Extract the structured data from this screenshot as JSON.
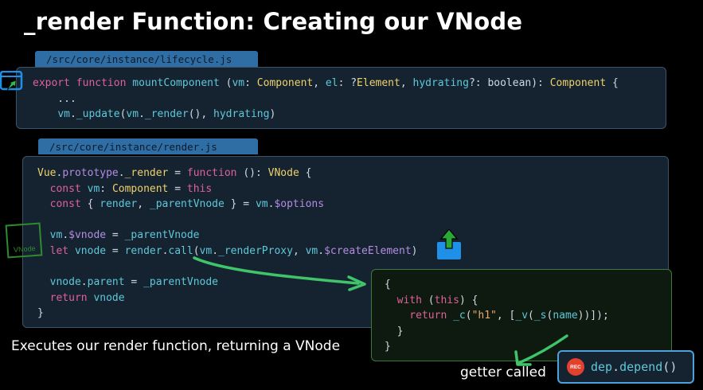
{
  "slide": {
    "title": "_render Function: Creating our VNode"
  },
  "block1": {
    "file": "/src/core/instance/lifecycle.js",
    "lines": [
      [
        [
          "kw",
          "export "
        ],
        [
          "kw",
          "function "
        ],
        [
          "fn",
          "mountComponent "
        ],
        [
          "pl",
          "("
        ],
        [
          "fn",
          "vm"
        ],
        [
          "pl",
          ": "
        ],
        [
          "ty",
          "Component"
        ],
        [
          "pl",
          ", "
        ],
        [
          "fn",
          "el"
        ],
        [
          "pl",
          ": ?"
        ],
        [
          "ty",
          "Element"
        ],
        [
          "pl",
          ", "
        ],
        [
          "fn",
          "hydrating"
        ],
        [
          "pl",
          "?: "
        ],
        [
          "pl",
          "boolean"
        ],
        [
          "pl",
          "): "
        ],
        [
          "ty",
          "Component"
        ],
        [
          "pl",
          " {"
        ]
      ],
      [
        [
          "pl",
          "    ..."
        ]
      ],
      [
        [
          "pl",
          "    "
        ],
        [
          "fn",
          "vm"
        ],
        [
          "pl",
          "."
        ],
        [
          "fn",
          "_update"
        ],
        [
          "pl",
          "("
        ],
        [
          "fn",
          "vm"
        ],
        [
          "pl",
          "."
        ],
        [
          "fn",
          "_render"
        ],
        [
          "pl",
          "(), "
        ],
        [
          "fn",
          "hydrating"
        ],
        [
          "pl",
          ")"
        ]
      ]
    ]
  },
  "block2": {
    "file": "/src/core/instance/render.js",
    "lines": [
      [
        [
          "ty",
          "Vue"
        ],
        [
          "pl",
          "."
        ],
        [
          "pr",
          "prototype"
        ],
        [
          "pl",
          "."
        ],
        [
          "ty",
          "_render"
        ],
        [
          "pl",
          " = "
        ],
        [
          "kw",
          "function "
        ],
        [
          "pl",
          "(): "
        ],
        [
          "ty",
          "VNode"
        ],
        [
          "pl",
          " {"
        ]
      ],
      [
        [
          "kw",
          "  const "
        ],
        [
          "fn",
          "vm"
        ],
        [
          "pl",
          ": "
        ],
        [
          "ty",
          "Component"
        ],
        [
          "pl",
          " = "
        ],
        [
          "kw",
          "this"
        ]
      ],
      [
        [
          "kw",
          "  const "
        ],
        [
          "pl",
          "{ "
        ],
        [
          "fn",
          "render"
        ],
        [
          "pl",
          ", "
        ],
        [
          "fn",
          "_parentVnode"
        ],
        [
          "pl",
          " } = "
        ],
        [
          "fn",
          "vm"
        ],
        [
          "pl",
          "."
        ],
        [
          "pr",
          "$options"
        ]
      ],
      [
        [
          "pl",
          ""
        ]
      ],
      [
        [
          "pl",
          "  "
        ],
        [
          "fn",
          "vm"
        ],
        [
          "pl",
          "."
        ],
        [
          "pr",
          "$vnode"
        ],
        [
          "pl",
          " = "
        ],
        [
          "fn",
          "_parentVnode"
        ]
      ],
      [
        [
          "kw",
          "  let "
        ],
        [
          "fn",
          "vnode"
        ],
        [
          "pl",
          " = "
        ],
        [
          "fn",
          "render"
        ],
        [
          "pl",
          "."
        ],
        [
          "fn",
          "call"
        ],
        [
          "pl",
          "("
        ],
        [
          "fn",
          "vm"
        ],
        [
          "pl",
          "."
        ],
        [
          "fn",
          "_renderProxy"
        ],
        [
          "pl",
          ", "
        ],
        [
          "fn",
          "vm"
        ],
        [
          "pl",
          "."
        ],
        [
          "pr",
          "$createElement"
        ],
        [
          "pl",
          ")"
        ]
      ],
      [
        [
          "pl",
          ""
        ]
      ],
      [
        [
          "pl",
          "  "
        ],
        [
          "fn",
          "vnode"
        ],
        [
          "pl",
          "."
        ],
        [
          "fn",
          "parent"
        ],
        [
          "pl",
          " = "
        ],
        [
          "fn",
          "_parentVnode"
        ]
      ],
      [
        [
          "kw",
          "  return "
        ],
        [
          "fn",
          "vnode"
        ]
      ],
      [
        [
          "pl",
          "}"
        ]
      ]
    ]
  },
  "block3": {
    "lines": [
      [
        [
          "pl",
          "{"
        ]
      ],
      [
        [
          "kw",
          "  with "
        ],
        [
          "pl",
          "("
        ],
        [
          "kw",
          "this"
        ],
        [
          "pl",
          ") {"
        ]
      ],
      [
        [
          "kw",
          "    return "
        ],
        [
          "fn",
          "_c"
        ],
        [
          "pl",
          "("
        ],
        [
          "st",
          "\"h1\""
        ],
        [
          "pl",
          ", ["
        ],
        [
          "fn",
          "_v"
        ],
        [
          "pl",
          "("
        ],
        [
          "fn",
          "_s"
        ],
        [
          "pl",
          "("
        ],
        [
          "fn",
          "name"
        ],
        [
          "pl",
          ")"
        ],
        [
          "pl",
          ")]);"
        ]
      ],
      [
        [
          "pl",
          "  }"
        ]
      ],
      [
        [
          "pl",
          "}"
        ]
      ]
    ]
  },
  "captions": {
    "executes": "Executes our render function, returning a VNode",
    "getter": "getter called"
  },
  "dep": {
    "rec_label": "REC",
    "code_obj": "dep",
    "code_dot": ".",
    "code_fn": "depend",
    "code_paren": "()"
  },
  "stamp": {
    "label": "VNode"
  },
  "colors": {
    "keyword": "#e0609a",
    "function": "#5ec8d8",
    "type": "#f0d16a",
    "property": "#b48ce0",
    "string": "#e8a76d",
    "plain": "#cfd8e2",
    "tab": "#2f6ea5",
    "code_bg": "#152331",
    "arrow_green": "#3fc46a",
    "upload_blue": "#1e90e8"
  }
}
